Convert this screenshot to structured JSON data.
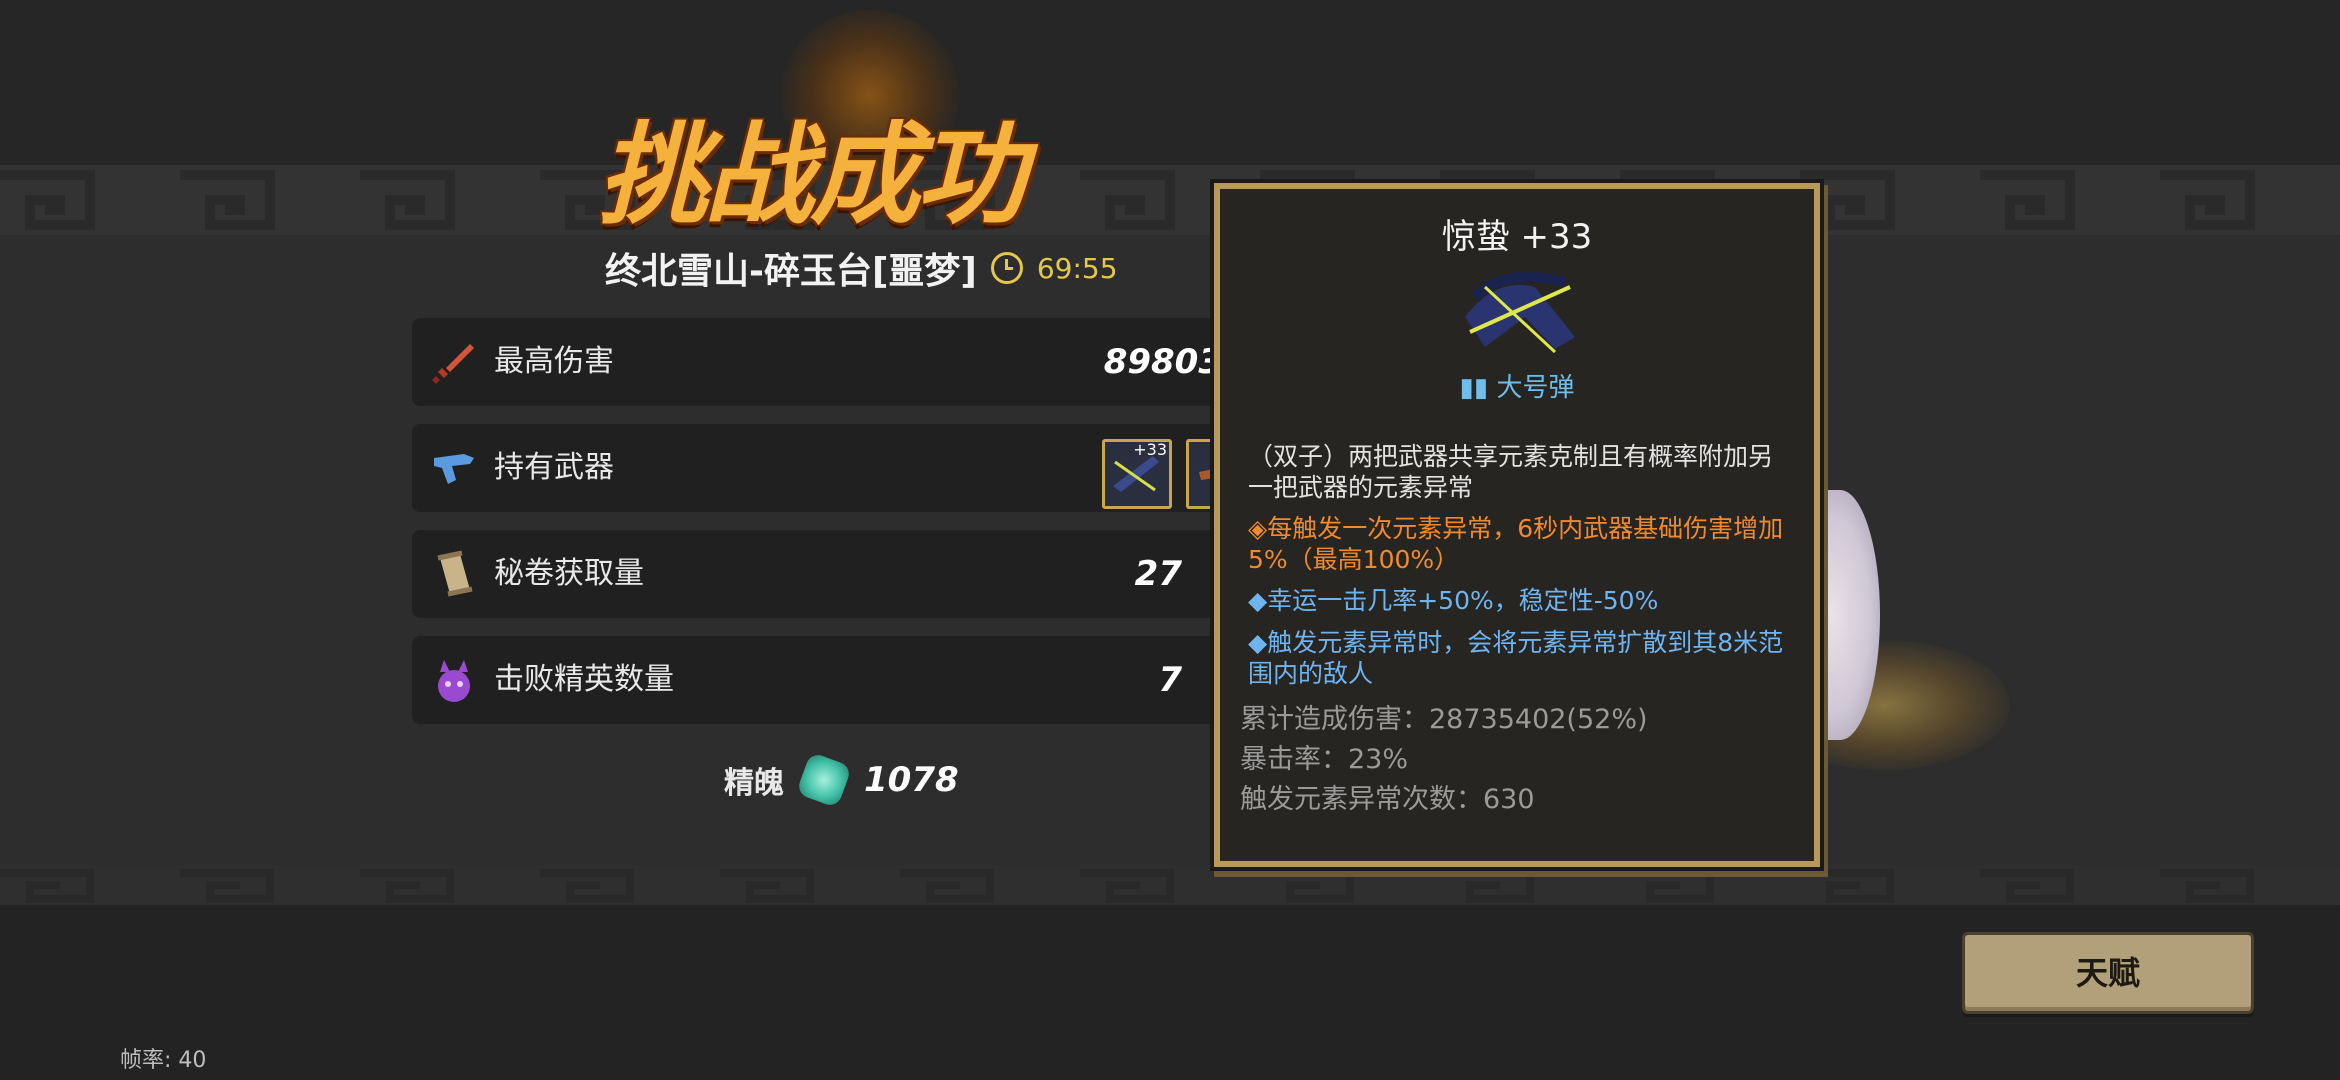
{
  "header": {
    "title": "挑战成功",
    "stage": "终北雪山-碎玉台[噩梦]",
    "time": "69:55"
  },
  "stats": [
    {
      "icon": "sword-icon",
      "label": "最高伤害",
      "value": "89803"
    },
    {
      "icon": "gun-icon",
      "label": "持有武器",
      "value": ""
    },
    {
      "icon": "scroll-icon",
      "label": "秘卷获取量",
      "value": "27"
    },
    {
      "icon": "elite-demon-icon",
      "label": "击败精英数量",
      "value": "7"
    }
  ],
  "weapons": [
    {
      "level": "+33",
      "icon": "crossbow-icon"
    },
    {
      "level": "",
      "icon": "weapon-icon"
    }
  ],
  "essence": {
    "label": "精魄",
    "value": "1078",
    "icon": "essence-gem-icon"
  },
  "tooltip": {
    "name": "惊蛰 +33",
    "ammo": "大号弹",
    "desc1": "（双子）两把武器共享元素克制且有概率附加另一把武器的元素异常",
    "desc2": "◈每触发一次元素异常，6秒内武器基础伤害增加5%（最高100%）",
    "desc3": "◆幸运一击几率+50%，稳定性-50%",
    "desc4": "◆触发元素异常时，会将元素异常扩散到其8米范围内的敌人",
    "stat_damage": "累计造成伤害：28735402(52%)",
    "stat_crit": "暴击率：23%",
    "stat_trigger": "触发元素异常次数：630"
  },
  "buttons": {
    "talent": "天赋"
  },
  "fps_label": "帧率: 40",
  "colors": {
    "accent_gold": "#b8995a",
    "orange": "#f08a2c",
    "blue": "#6fb4ee",
    "clock": "#e3c84a"
  }
}
